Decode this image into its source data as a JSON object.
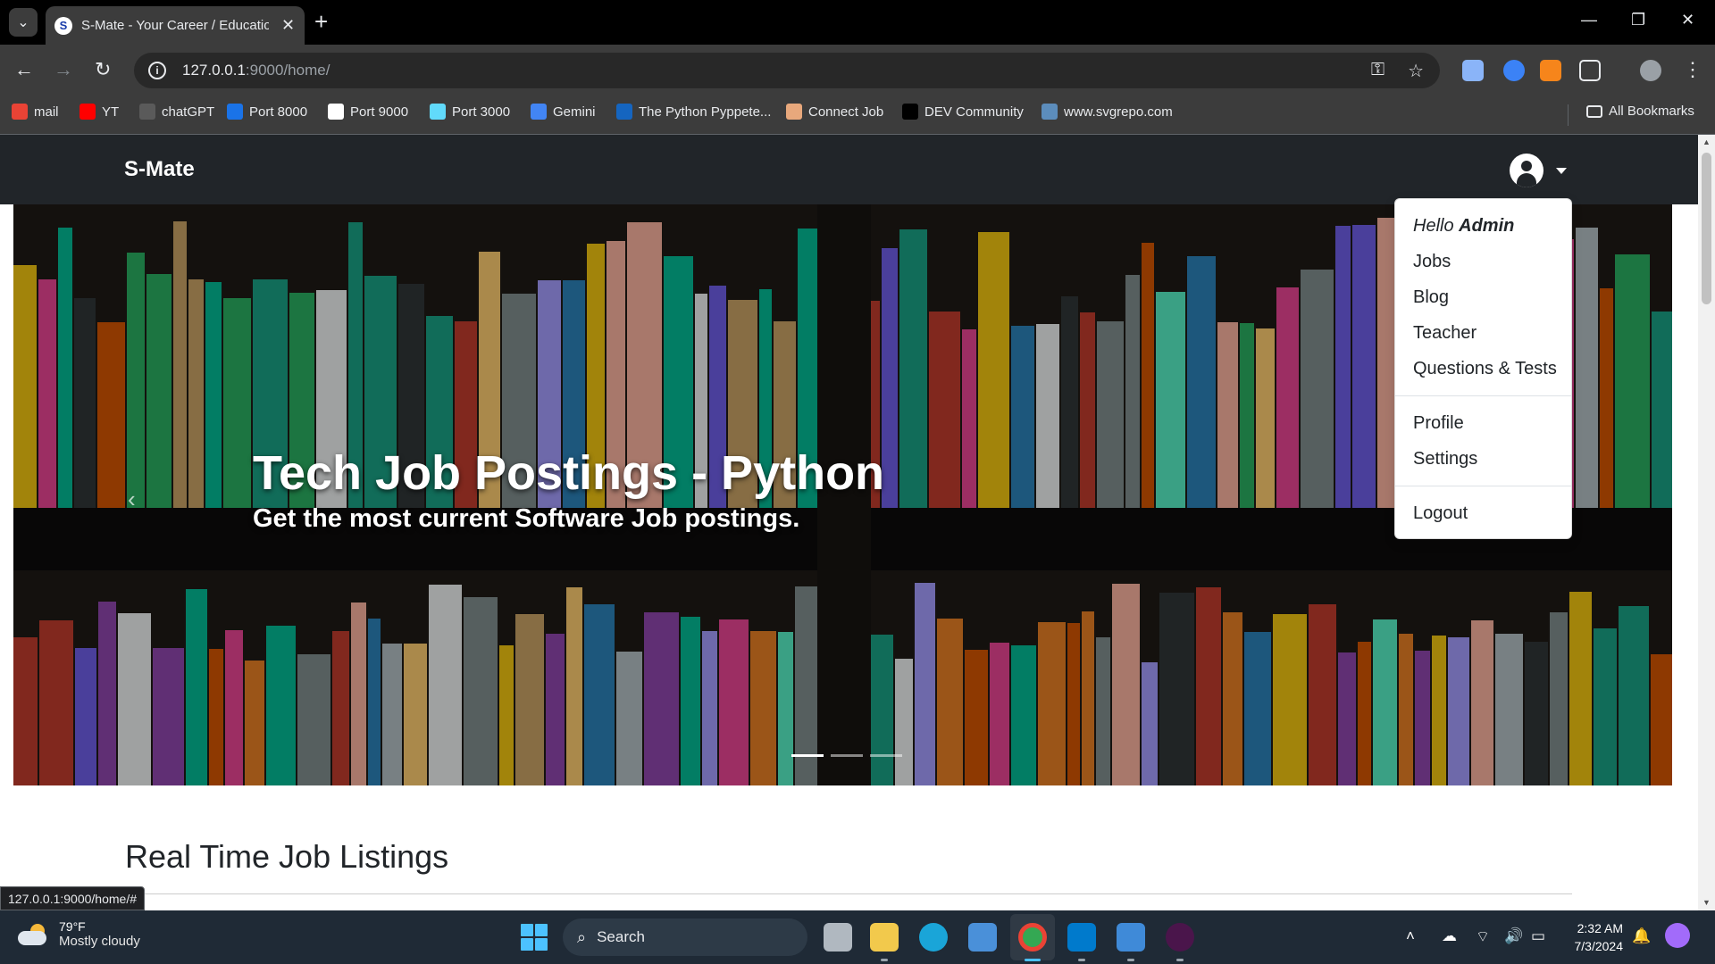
{
  "browser": {
    "tab_title": "S-Mate - Your Career / Education",
    "url_host": "127.0.0.1",
    "url_rest": ":9000/home/",
    "status_url": "127.0.0.1:9000/home/#",
    "all_bookmarks": "All Bookmarks",
    "bookmarks": [
      {
        "label": "mail",
        "icon": "gmail-icon",
        "color": "#ea4335"
      },
      {
        "label": "YT",
        "icon": "youtube-icon",
        "color": "#ff0000"
      },
      {
        "label": "chatGPT",
        "icon": "chatgpt-icon",
        "color": "#5a5a5a"
      },
      {
        "label": "Port 8000",
        "icon": "port-icon",
        "color": "#1a73e8"
      },
      {
        "label": "Port 9000",
        "icon": "smate-icon",
        "color": "#ffffff"
      },
      {
        "label": "Port 3000",
        "icon": "react-icon",
        "color": "#61dafb"
      },
      {
        "label": "Gemini",
        "icon": "gemini-icon",
        "color": "#4285f4"
      },
      {
        "label": "The Python Pyppete...",
        "icon": "python-icon",
        "color": "#1565c0"
      },
      {
        "label": "Connect Job",
        "icon": "people-icon",
        "color": "#e8a87c"
      },
      {
        "label": "DEV Community",
        "icon": "dev-icon",
        "color": "#000000"
      },
      {
        "label": "www.svgrepo.com",
        "icon": "svgrepo-icon",
        "color": "#5c8dbc"
      }
    ]
  },
  "site": {
    "brand": "S-Mate",
    "hero": {
      "title": "Tech Job Postings - Python",
      "subtitle": "Get the most current Software Job postings.",
      "slides": 3,
      "active_slide": 1
    },
    "dropdown": {
      "hello_prefix": "Hello",
      "hello_name": "Admin",
      "items_1": [
        "Jobs",
        "Blog",
        "Teacher",
        "Questions & Tests"
      ],
      "items_2": [
        "Profile",
        "Settings"
      ],
      "logout": "Logout"
    },
    "section_title": "Real Time Job Listings"
  },
  "taskbar": {
    "temp": "79°F",
    "condition": "Mostly cloudy",
    "search": "Search",
    "time": "2:32 AM",
    "date": "7/3/2024"
  }
}
